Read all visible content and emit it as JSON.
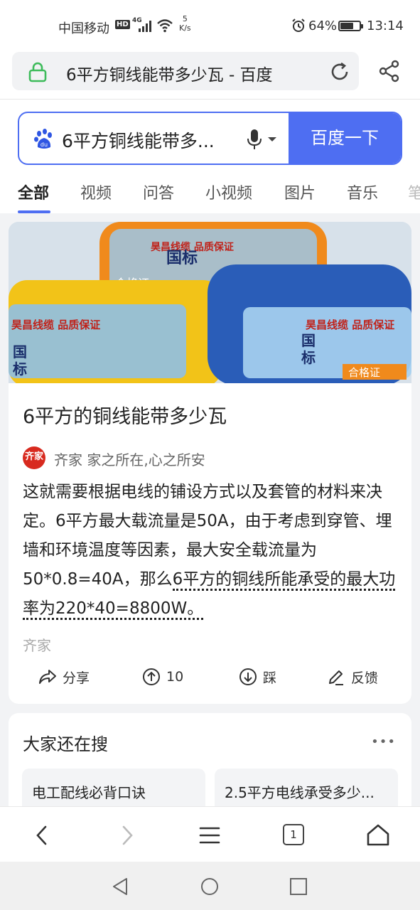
{
  "status_bar": {
    "carrier": "中国移动",
    "hd": "HD",
    "network": "4G",
    "speed_value": "5",
    "speed_unit": "K/s",
    "battery": "64%",
    "battery_level": 0.64,
    "time": "13:14"
  },
  "url_bar": {
    "title": "6平方铜线能带多少瓦 - 百度"
  },
  "search": {
    "query": "6平方铜线能带多...",
    "button": "百度一下"
  },
  "tabs": [
    "全部",
    "视频",
    "问答",
    "小视频",
    "图片",
    "音乐",
    "笔"
  ],
  "result": {
    "title": "6平方的铜线能带多少瓦",
    "source_logo": "齐家",
    "source_name": "齐家 家之所在,心之所安",
    "abstract_plain": "这就需要根据电线的铺设方式以及套管的材料来决定。6平方最大载流量是50A，由于考虑到穿管、埋墙和环境温度等因素，最大安全载流量为50*0.8=40A，那么",
    "abstract_highlight": "6平方的铜线所能承受的最大功率为220*40=8800W。",
    "footer_source": "齐家",
    "actions": {
      "share": "分享",
      "upvote": "10",
      "downvote": "踩",
      "feedback": "反馈"
    },
    "image_text": {
      "brand_top": "昊昌线缆 品质保证",
      "brand_left": "昊昌线缆 品质保证",
      "brand_right": "昊昌线缆 品质保证",
      "guobiao": "国标",
      "certificate": "合格证"
    }
  },
  "related": {
    "heading": "大家还在搜",
    "more": "•••",
    "items": [
      "电工配线必背口诀",
      "2.5平方电线承受多少..."
    ]
  },
  "toolbar": {
    "tab_count": "1"
  },
  "colors": {
    "accent": "#4e6ef2",
    "secure_green": "#3dbb5a",
    "source_red": "#d82a1f"
  }
}
